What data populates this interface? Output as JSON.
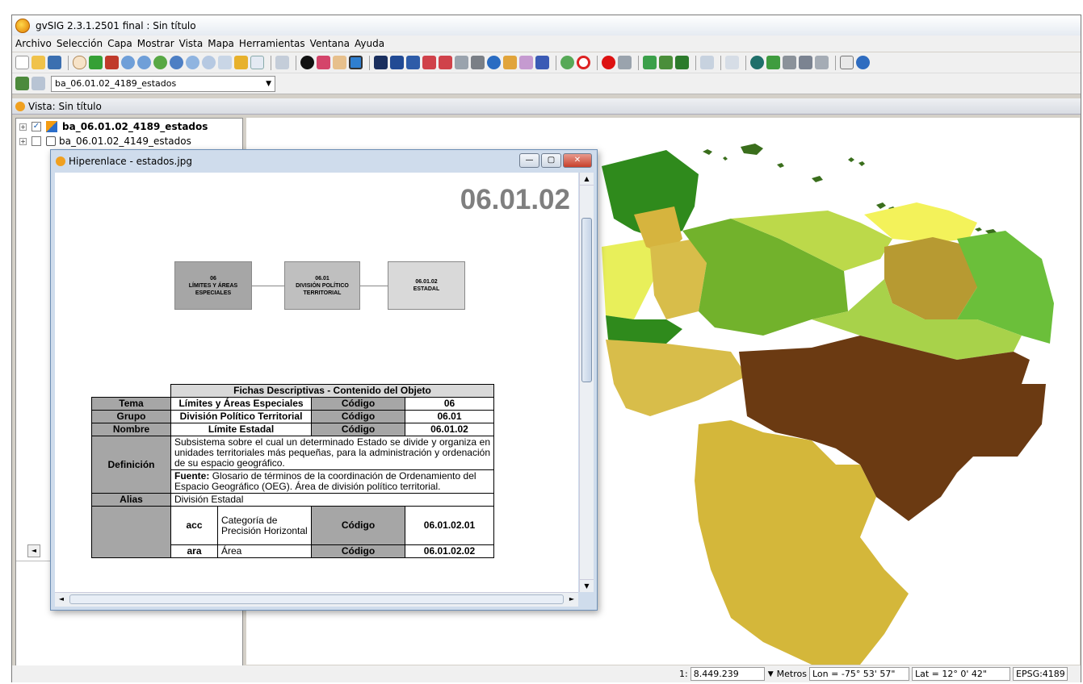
{
  "app": {
    "title": "gvSIG 2.3.1.2501 final : Sin título",
    "menu": [
      "Archivo",
      "Selección",
      "Capa",
      "Mostrar",
      "Vista",
      "Mapa",
      "Herramientas",
      "Ventana",
      "Ayuda"
    ],
    "active_layer_combo": "ba_06.01.02_4189_estados"
  },
  "view": {
    "title": "Vista: Sin título",
    "layers": [
      {
        "name": "ba_06.01.02_4189_estados",
        "checked": true
      },
      {
        "name": "ba_06.01.02_4149_estados",
        "checked": false
      }
    ]
  },
  "hyperlink_window": {
    "title": "Hiperenlace - estados.jpg",
    "code": "06.01.02",
    "hierarchy": [
      {
        "line1": "06",
        "line2": "LÍMITES Y ÁREAS",
        "line3": "ESPECIALES"
      },
      {
        "line1": "06.01",
        "line2": "DIVISIÓN POLÍTICO",
        "line3": "TERRITORIAL"
      },
      {
        "line1": "06.01.02",
        "line2": "ESTADAL",
        "line3": ""
      }
    ],
    "table": {
      "header": "Fichas Descriptivas - Contenido del Objeto",
      "tema_label": "Tema",
      "tema_value": "Límites y Áreas Especiales",
      "tema_code_label": "Código",
      "tema_code": "06",
      "grupo_label": "Grupo",
      "grupo_value": "División Político Territorial",
      "grupo_code_label": "Código",
      "grupo_code": "06.01",
      "nombre_label": "Nombre",
      "nombre_value": "Límite Estadal",
      "nombre_code_label": "Código",
      "nombre_code": "06.01.02",
      "definicion_label": "Definición",
      "definicion_text": "Subsistema sobre el cual un determinado Estado se divide y organiza en unidades territoriales más pequeñas, para la administración y ordenación de su espacio geográfico.",
      "fuente_label": "Fuente:",
      "fuente_text": "Glosario de términos de la coordinación de Ordenamiento del Espacio Geográfico (OEG). Área de división político territorial.",
      "alias_label": "Alias",
      "alias_value": "División Estadal",
      "attr1_code": "acc",
      "attr1_name": "Categoría de Precisión Horizontal",
      "attr1_code_label": "Código",
      "attr1_value": "06.01.02.01",
      "attr2_code": "ara",
      "attr2_name": "Área",
      "attr2_code_label": "Código",
      "attr2_value": "06.01.02.02"
    }
  },
  "statusbar": {
    "scale_prefix": "1:",
    "scale": "8.449.239",
    "units": "Metros",
    "lon": "Lon = -75° 53' 57\"",
    "lat": "Lat = 12° 0' 42\"",
    "epsg": "EPSG:4189"
  },
  "colors": {
    "dark_brown": "#6b3a12",
    "ochre": "#d6b43e",
    "olive": "#b79a32",
    "green": "#7ab82a",
    "dark_green": "#2f8a1c",
    "lime": "#bcd94a",
    "yellow": "#f3f25a"
  }
}
